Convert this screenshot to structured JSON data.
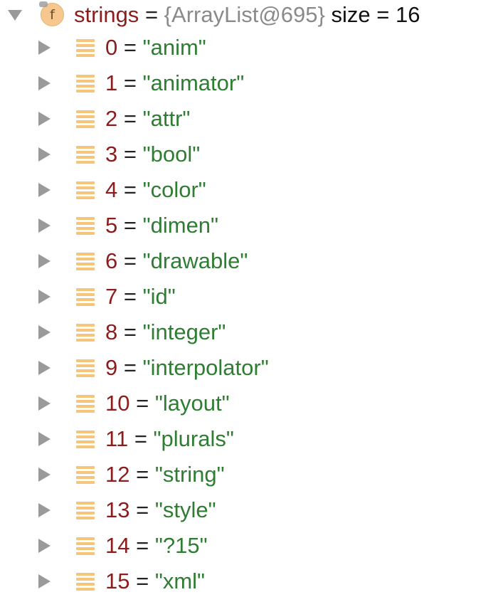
{
  "root": {
    "icon": "field-icon",
    "icon_glyph": "f",
    "name": "strings",
    "equals": "=",
    "type_label": "{ArrayList@695}",
    "size_text": "size = 16",
    "expanded": true
  },
  "items": [
    {
      "index": "0",
      "equals": "=",
      "value": "\"anim\""
    },
    {
      "index": "1",
      "equals": "=",
      "value": "\"animator\""
    },
    {
      "index": "2",
      "equals": "=",
      "value": "\"attr\""
    },
    {
      "index": "3",
      "equals": "=",
      "value": "\"bool\""
    },
    {
      "index": "4",
      "equals": "=",
      "value": "\"color\""
    },
    {
      "index": "5",
      "equals": "=",
      "value": "\"dimen\""
    },
    {
      "index": "6",
      "equals": "=",
      "value": "\"drawable\""
    },
    {
      "index": "7",
      "equals": "=",
      "value": "\"id\""
    },
    {
      "index": "8",
      "equals": "=",
      "value": "\"integer\""
    },
    {
      "index": "9",
      "equals": "=",
      "value": "\"interpolator\""
    },
    {
      "index": "10",
      "equals": "=",
      "value": "\"layout\""
    },
    {
      "index": "11",
      "equals": "=",
      "value": "\"plurals\""
    },
    {
      "index": "12",
      "equals": "=",
      "value": "\"string\""
    },
    {
      "index": "13",
      "equals": "=",
      "value": "\"style\""
    },
    {
      "index": "14",
      "equals": "=",
      "value": "\"?15\""
    },
    {
      "index": "15",
      "equals": "=",
      "value": "\"xml\""
    }
  ],
  "icons": {
    "root_toggle": "chevron-down-icon",
    "item_toggle": "chevron-right-icon",
    "item_icon": "list-icon"
  },
  "colors": {
    "variable_name": "#8b1d1d",
    "string_value": "#2e7d32",
    "type_text": "#8a8a8a",
    "tree_arrow": "#9a9a9a",
    "icon_orange": "#f4c57a"
  }
}
